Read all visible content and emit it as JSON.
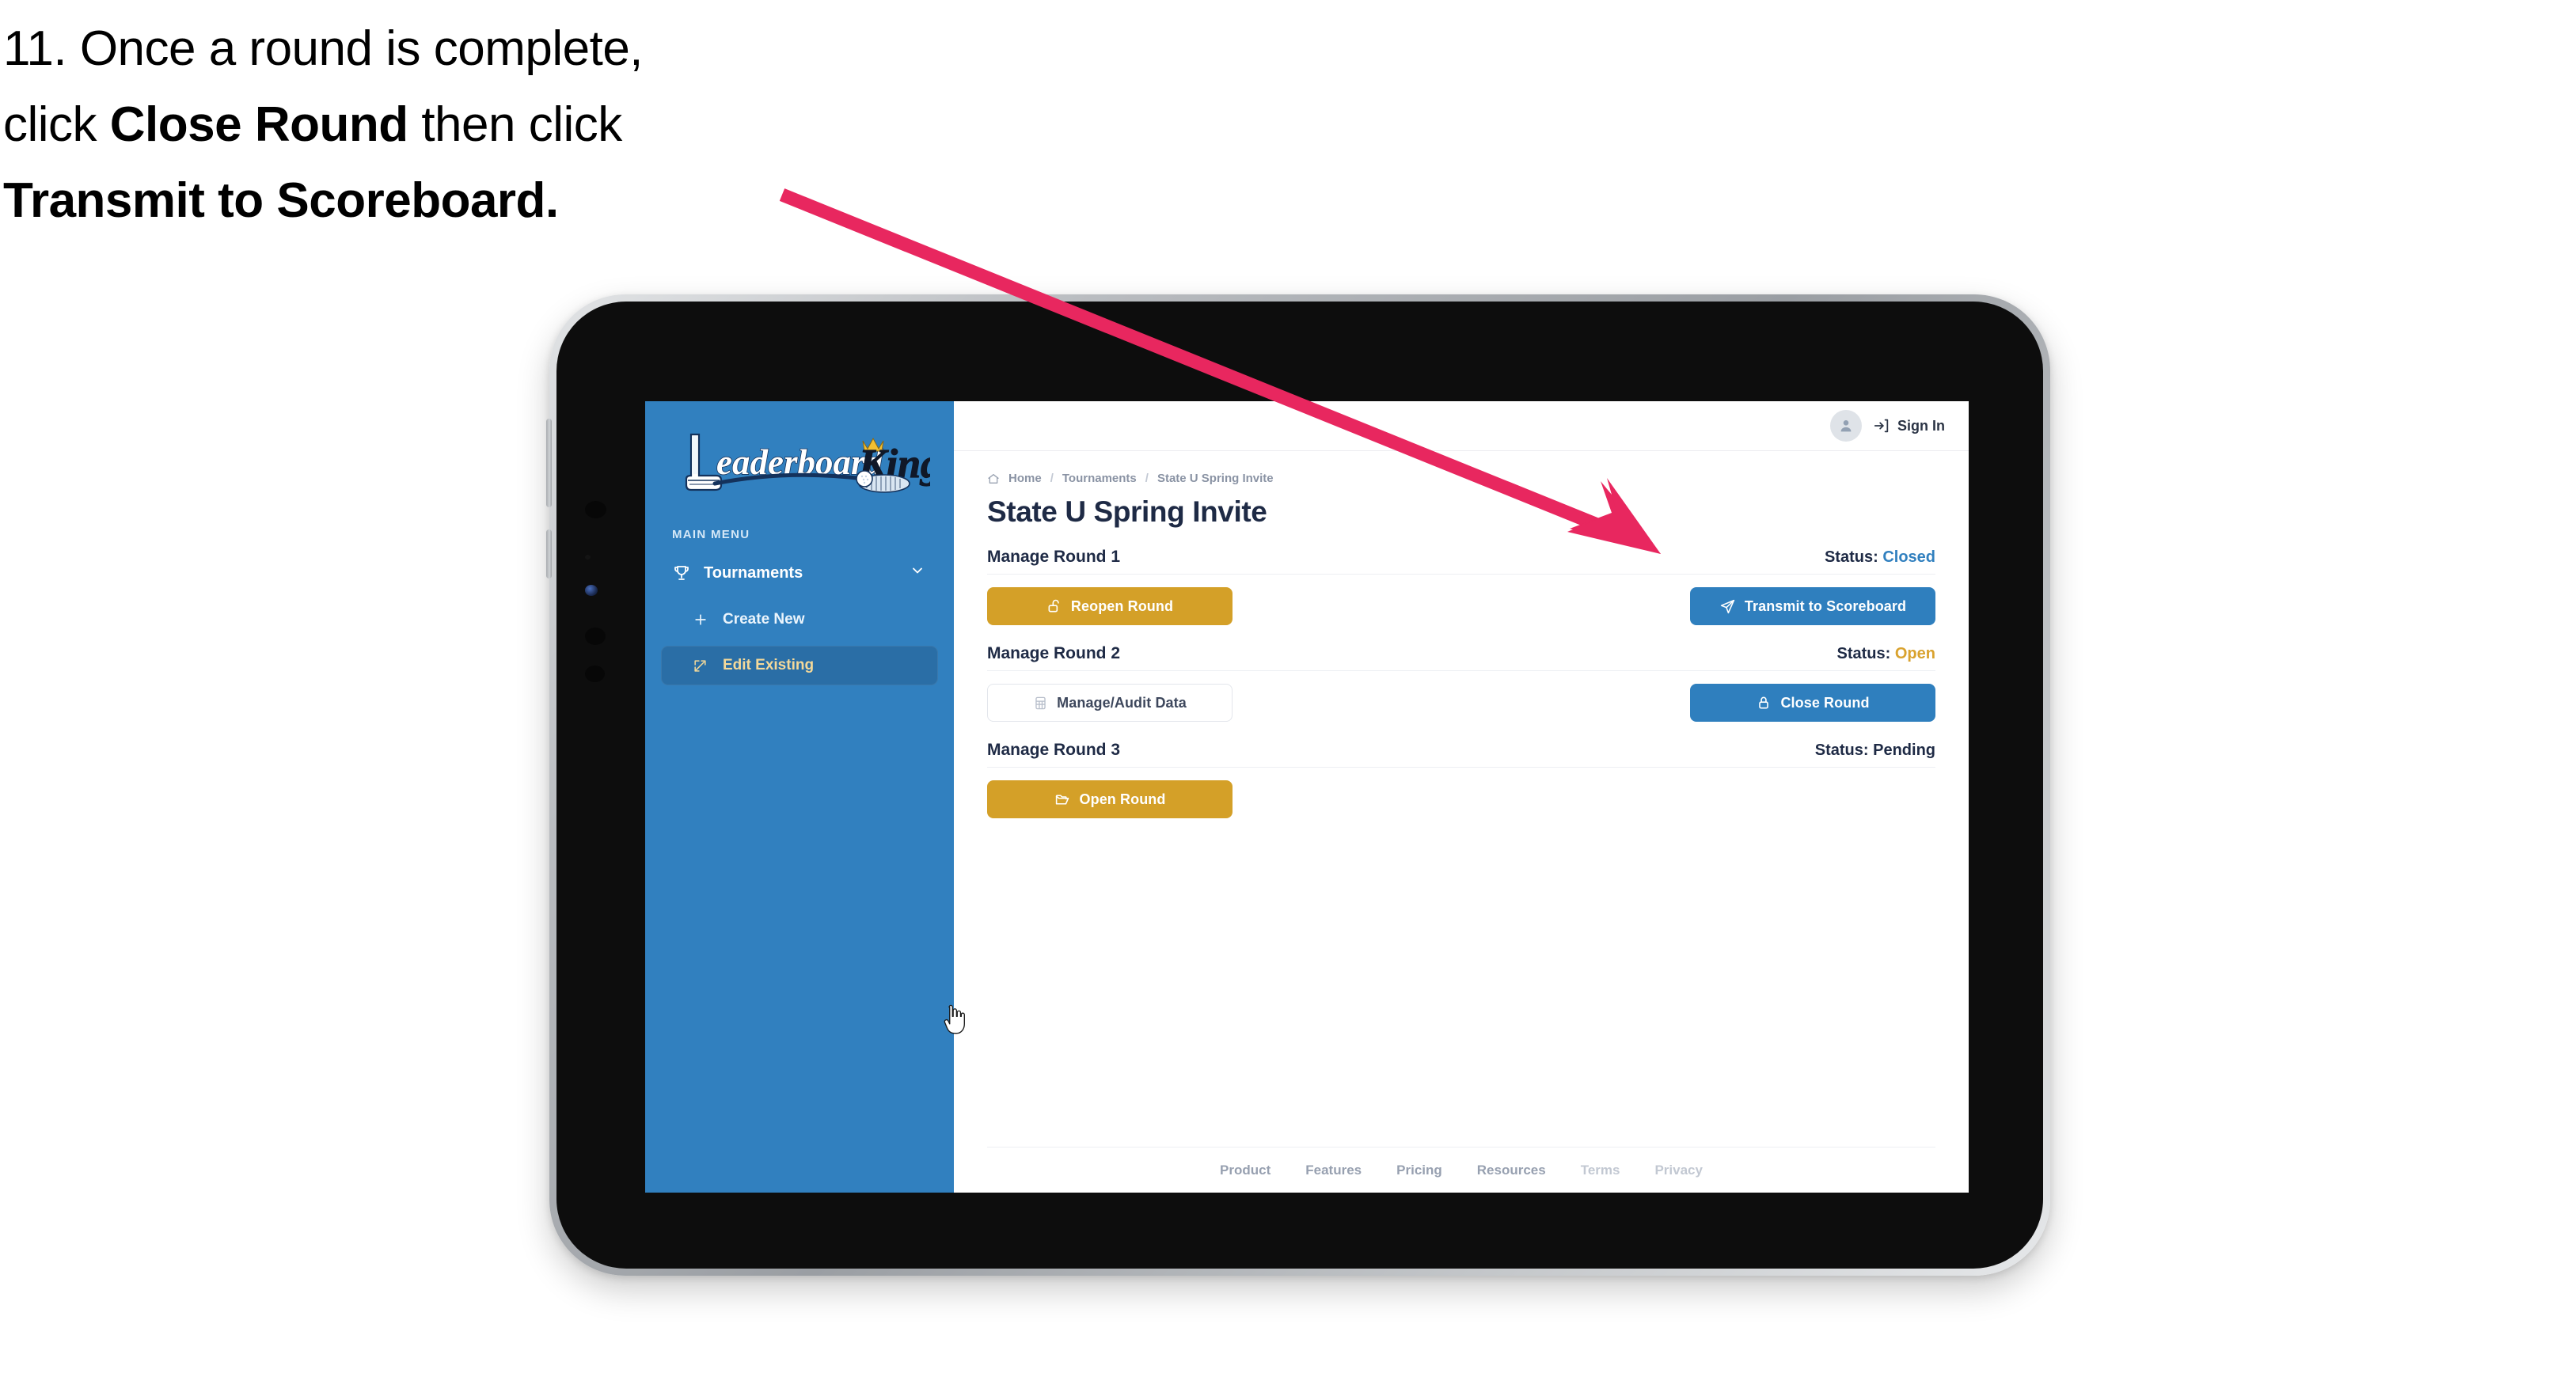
{
  "instruction": {
    "step_number": "11.",
    "line1_plain": "11. Once a round is complete,",
    "line2_prefix": "click ",
    "line2_bold": "Close Round",
    "line2_suffix": " then click",
    "line3_bold": "Transmit to Scoreboard.",
    "full_text": "11. Once a round is complete, click Close Round then click Transmit to Scoreboard."
  },
  "annotation": {
    "arrow_color": "#e8275f",
    "points_to": "Transmit to Scoreboard"
  },
  "app": {
    "brand": {
      "name_part1": "Leaderboard",
      "name_part2": "King",
      "logo_icon": "golf-putter-and-crown-logo"
    },
    "sidebar": {
      "section_label": "MAIN MENU",
      "accent_bg": "#3180bf",
      "items": [
        {
          "label": "Tournaments",
          "icon": "trophy-icon",
          "expandable": true,
          "chevron": "chevron-down-icon",
          "active": false
        },
        {
          "label": "Create New",
          "icon": "plus-icon",
          "active": false
        },
        {
          "label": "Edit Existing",
          "icon": "edit-square-icon",
          "active": true
        }
      ]
    },
    "topbar": {
      "avatar_icon": "user-avatar-icon",
      "signin_icon": "sign-in-arrow-icon",
      "signin_label": "Sign In"
    },
    "breadcrumb": {
      "home_icon": "home-icon",
      "separator": "/",
      "items": [
        "Home",
        "Tournaments",
        "State U Spring Invite"
      ]
    },
    "page_title": "State U Spring Invite",
    "rounds": [
      {
        "name": "Manage Round 1",
        "status_label": "Status:",
        "status_value": "Closed",
        "status_color": "#3180bf",
        "left_button": {
          "label": "Reopen Round",
          "icon": "unlock-icon",
          "style": "amber"
        },
        "right_button": {
          "label": "Transmit to Scoreboard",
          "icon": "send-plane-icon",
          "style": "blue"
        }
      },
      {
        "name": "Manage Round 2",
        "status_label": "Status:",
        "status_value": "Open",
        "status_color": "#d9a22e",
        "left_button": {
          "label": "Manage/Audit Data",
          "icon": "table-grid-icon",
          "style": "ghost"
        },
        "right_button": {
          "label": "Close Round",
          "icon": "lock-icon",
          "style": "blue"
        }
      },
      {
        "name": "Manage Round 3",
        "status_label": "Status:",
        "status_value": "Pending",
        "status_color": "#1e2a45",
        "left_button": {
          "label": "Open Round",
          "icon": "open-folder-icon",
          "style": "amber"
        },
        "right_button": null
      }
    ],
    "footer": {
      "links": [
        {
          "label": "Product",
          "muted": false
        },
        {
          "label": "Features",
          "muted": false
        },
        {
          "label": "Pricing",
          "muted": false
        },
        {
          "label": "Resources",
          "muted": false
        },
        {
          "label": "Terms",
          "muted": true
        },
        {
          "label": "Privacy",
          "muted": true
        }
      ]
    },
    "cursor": {
      "icon": "pointing-hand-cursor",
      "over": "Edit Existing"
    }
  }
}
